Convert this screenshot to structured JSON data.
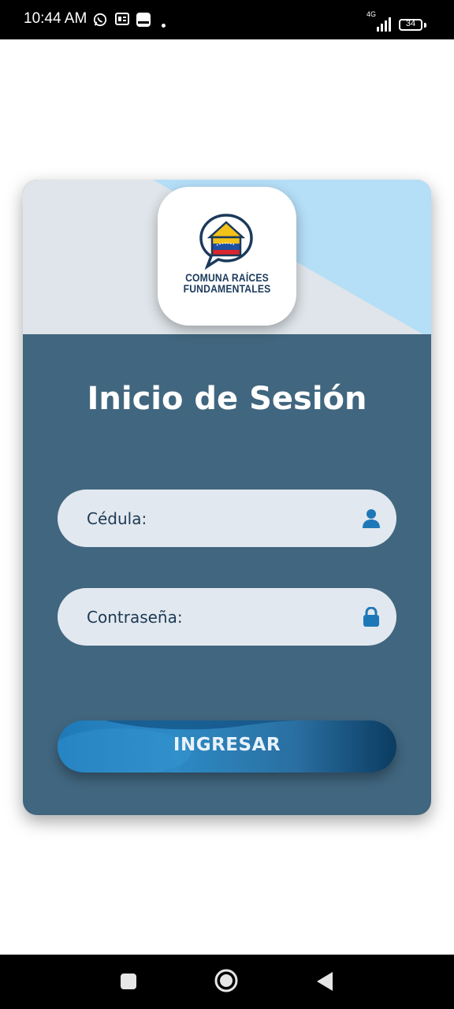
{
  "status_bar": {
    "time": "10:44 AM",
    "network": "4G",
    "battery": "34",
    "icons": [
      "whatsapp-icon",
      "ge-icon",
      "message-icon",
      "dot-icon",
      "signal-icon",
      "battery-icon"
    ]
  },
  "logo": {
    "line1": "COMUNA RAÍCES",
    "line2": "FUNDAMENTALES"
  },
  "login": {
    "title": "Inicio de Sesión",
    "cedula_label": "Cédula:",
    "cedula_value": "",
    "password_label": "Contraseña:",
    "password_value": "",
    "submit_label": "INGRESAR"
  },
  "colors": {
    "card_background": "#41667f",
    "card_top_gray": "#dfe5ea",
    "card_top_blue": "#b5def7",
    "field_background": "#e2e8ef",
    "icon_blue": "#1e78b8",
    "text_dark": "#1c3954"
  },
  "nav_bar": {
    "icons": [
      "recents-icon",
      "home-icon",
      "back-icon"
    ]
  }
}
